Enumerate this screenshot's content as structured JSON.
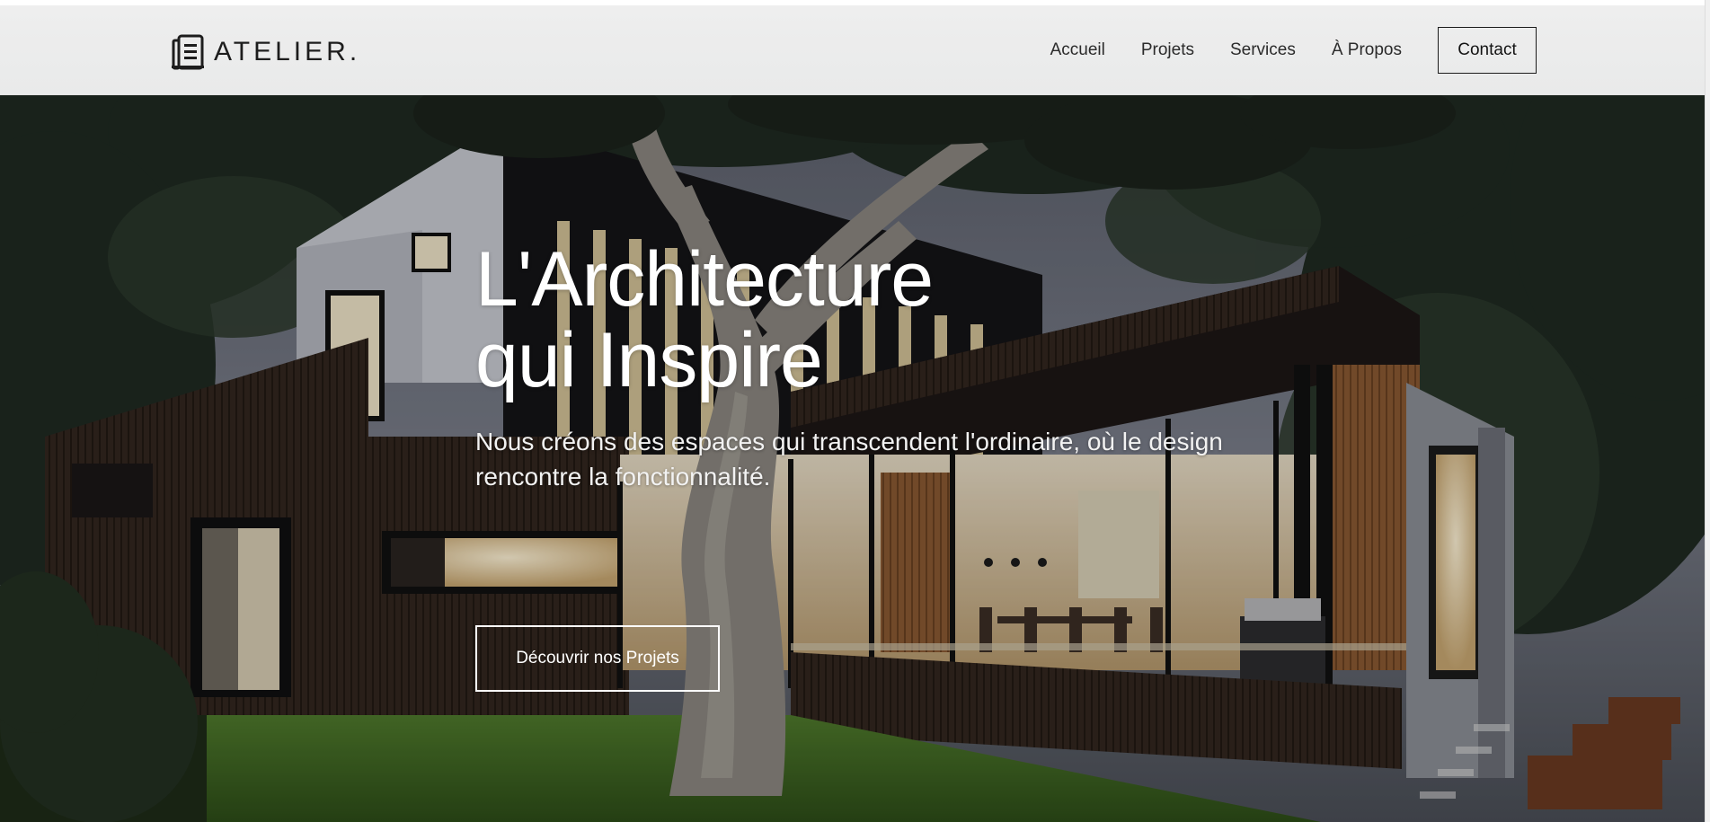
{
  "brand": {
    "name": "ATELIER.",
    "icon": "building-icon"
  },
  "nav": {
    "items": [
      {
        "label": "Accueil"
      },
      {
        "label": "Projets"
      },
      {
        "label": "Services"
      },
      {
        "label": "À Propos"
      }
    ],
    "contact_label": "Contact"
  },
  "hero": {
    "title_line1": "L'Architecture",
    "title_line2": "qui Inspire",
    "subtitle": "Nous créons des espaces qui transcendent l'ordinaire, où le design rencontre la fonctionnalité.",
    "cta_label": "Découvrir nos Projets",
    "background_image": "modern-house-at-dusk-photo"
  },
  "colors": {
    "header_bg": "#ececec",
    "text_dark": "#1d1d1d",
    "hero_text": "#ffffff"
  }
}
